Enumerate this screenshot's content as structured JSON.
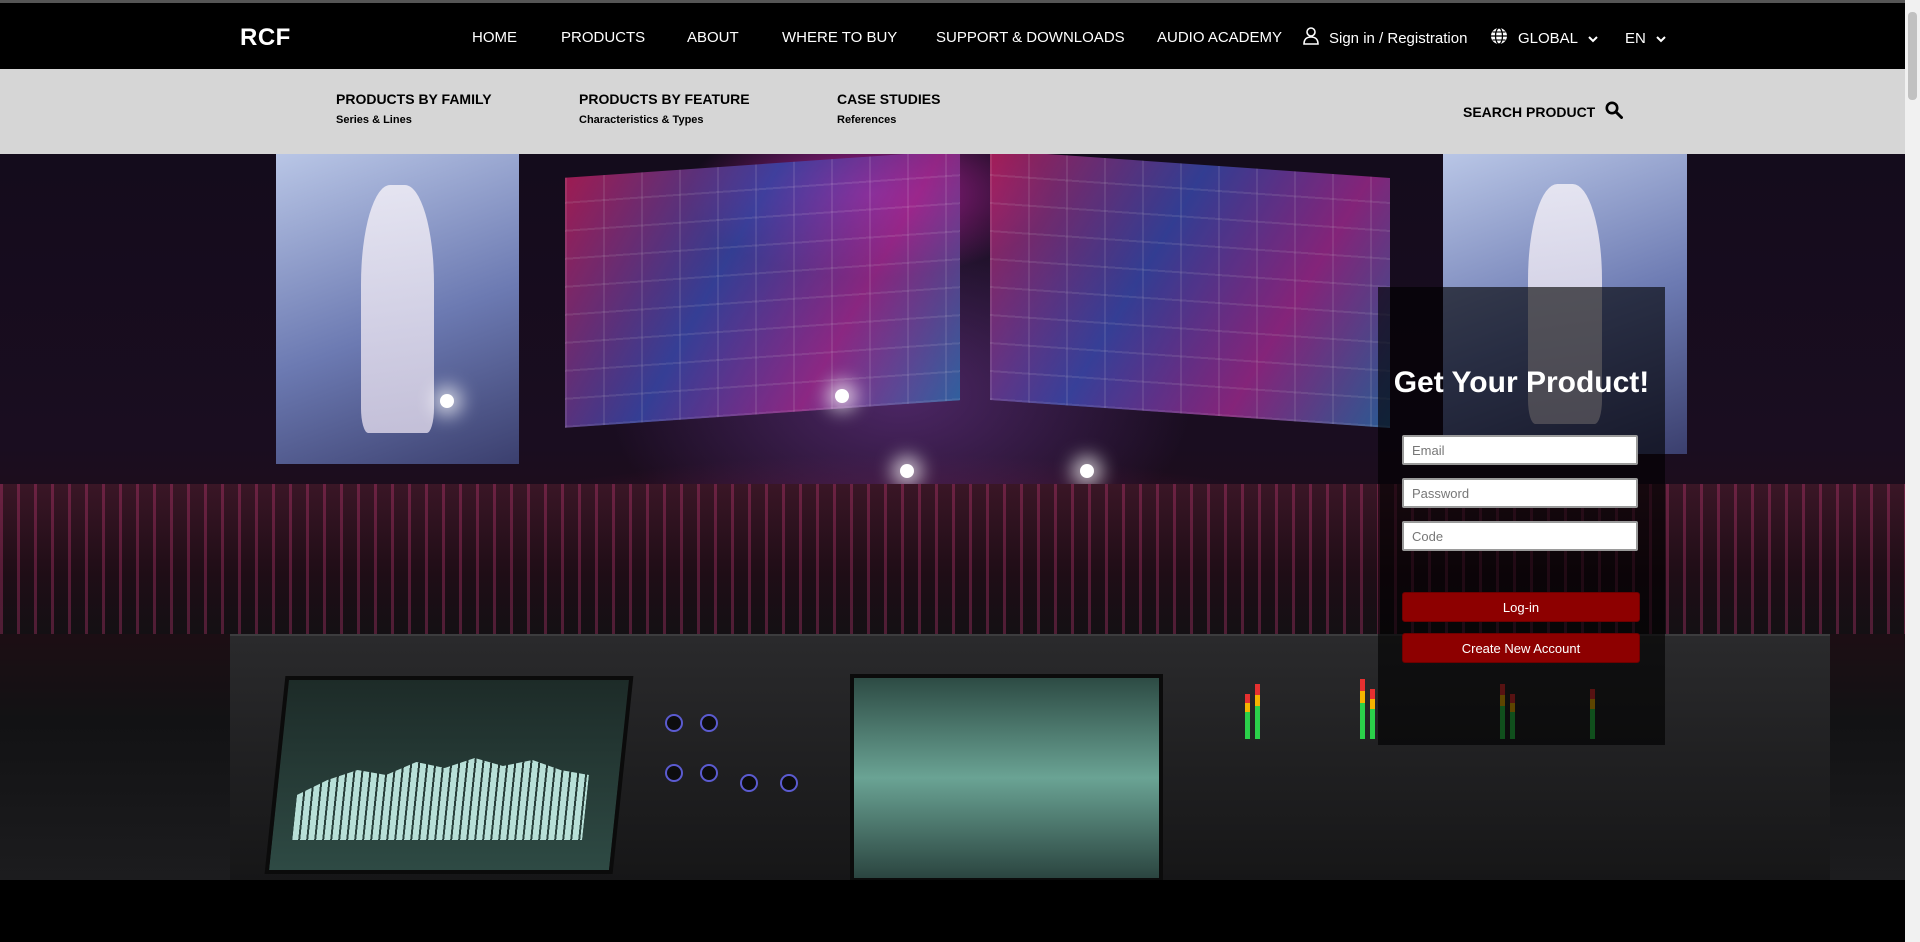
{
  "brand": {
    "logo": "RCF"
  },
  "nav": {
    "items": [
      "HOME",
      "PRODUCTS",
      "ABOUT",
      "WHERE TO BUY",
      "SUPPORT & DOWNLOADS",
      "AUDIO ACADEMY"
    ],
    "signin_label": "Sign in / Registration",
    "region_label": "GLOBAL",
    "language_label": "EN"
  },
  "subnav": {
    "items": [
      {
        "title": "PRODUCTS BY FAMILY",
        "desc": "Series & Lines"
      },
      {
        "title": "PRODUCTS BY FEATURE",
        "desc": "Characteristics & Types"
      },
      {
        "title": "CASE STUDIES",
        "desc": "References"
      }
    ],
    "search_label": "SEARCH PRODUCT"
  },
  "login": {
    "title": "Get Your Product!",
    "email_placeholder": "Email",
    "password_placeholder": "Password",
    "code_placeholder": "Code",
    "login_button": "Log-in",
    "create_button": "Create New Account"
  },
  "icons": {
    "user": "user-icon",
    "globe": "globe-icon",
    "chevron": "chevron-down-icon",
    "search": "search-icon"
  },
  "colors": {
    "nav_bg": "#000000",
    "subnav_bg": "#d6d6d6",
    "button_bg": "#8d0000"
  }
}
